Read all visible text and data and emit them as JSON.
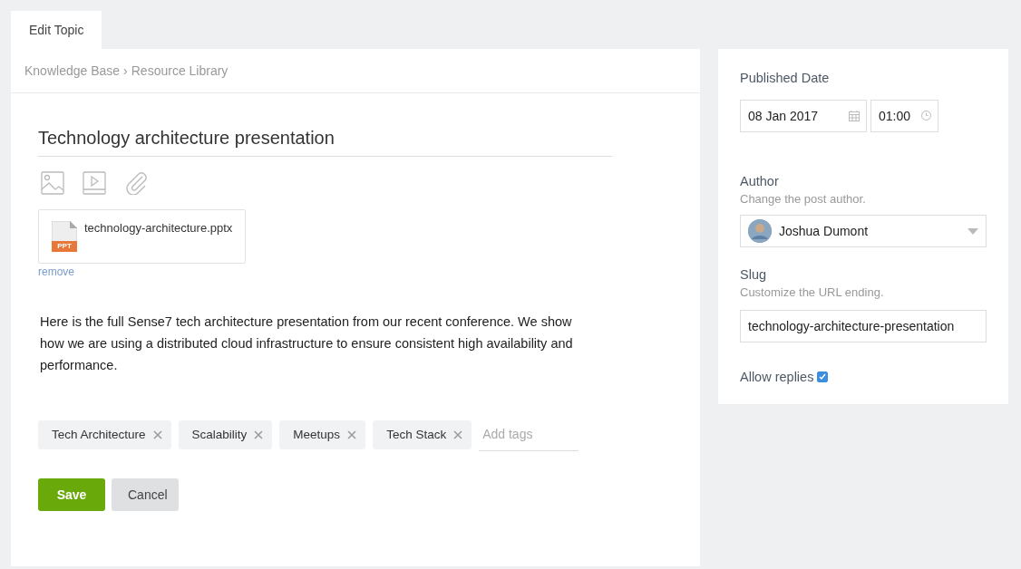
{
  "tabs": [
    {
      "label": "Edit Topic",
      "selected": true
    }
  ],
  "breadcrumb": {
    "items": [
      "Knowledge Base",
      "Resource Library"
    ],
    "separator": "›"
  },
  "editor": {
    "title": "Technology architecture presentation",
    "attachment": {
      "filename": "technology-architecture.pptx",
      "type_label": "PPT",
      "remove_link": "remove"
    },
    "body": "Here is the full Sense7 tech architecture presentation from our recent conference. We show how we are using a distributed cloud infrastructure to ensure consistent high availability and performance.",
    "tags": [
      "Tech Architecture",
      "Scalability",
      "Meetups",
      "Tech Stack"
    ],
    "tags_placeholder": "Add tags",
    "buttons": [
      {
        "label": "Save",
        "kind": "primary"
      },
      {
        "label": "Cancel",
        "kind": "secondary"
      }
    ]
  },
  "sidebar": {
    "published_date": {
      "label": "Published Date",
      "date": "08 Jan 2017",
      "time": "01:00"
    },
    "author": {
      "label": "Author",
      "hint": "Change the post author.",
      "value": "Joshua Dumont"
    },
    "slug": {
      "label": "Slug",
      "hint": "Customize the URL ending.",
      "value": "technology-architecture-presentation"
    },
    "allow_replies": {
      "label": "Allow replies",
      "checked": true
    }
  }
}
